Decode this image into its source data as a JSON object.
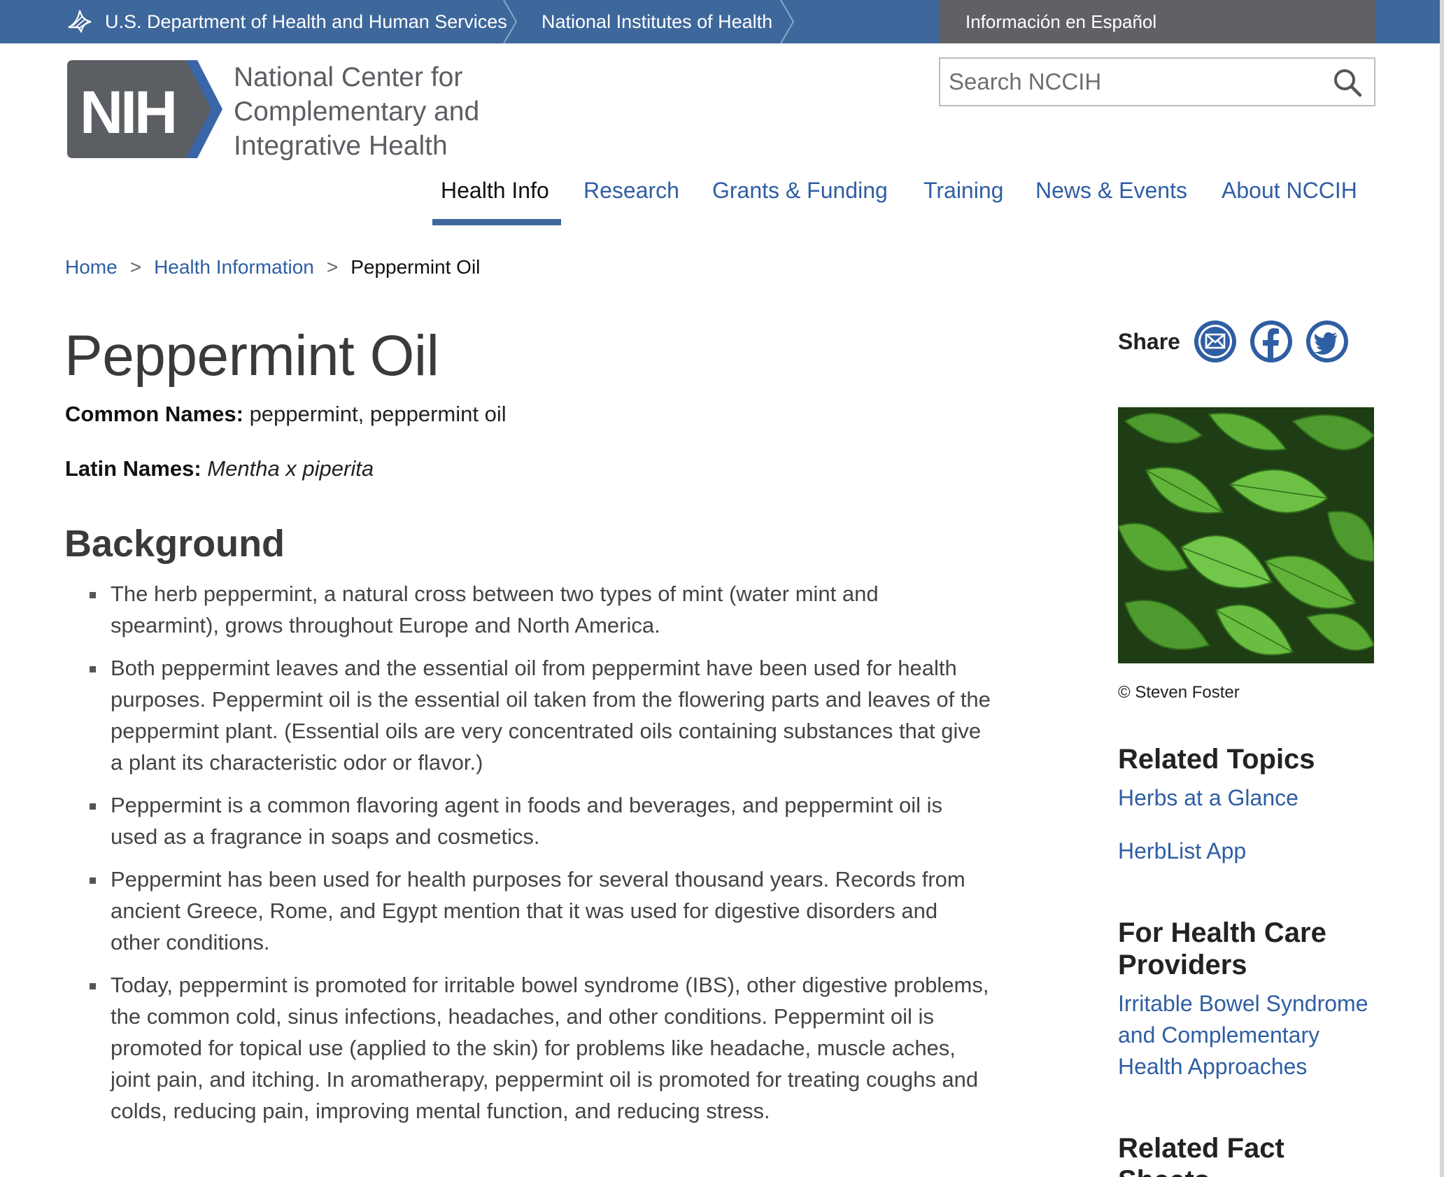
{
  "gov_bar": {
    "hhs_label": "U.S. Department of Health and Human Services",
    "nih_label": "National Institutes of Health",
    "espanol_label": "Información en Español"
  },
  "header": {
    "logo_text": "NIH",
    "org_line1": "National Center for",
    "org_line2": "Complementary and",
    "org_line3": "Integrative Health"
  },
  "search": {
    "placeholder": "Search NCCIH",
    "icon": "search-icon"
  },
  "nav": {
    "items": [
      {
        "label": "Health Info",
        "active": true
      },
      {
        "label": "Research"
      },
      {
        "label": "Grants & Funding"
      },
      {
        "label": "Training"
      },
      {
        "label": "News & Events"
      },
      {
        "label": "About NCCIH"
      }
    ]
  },
  "breadcrumb": {
    "home": "Home",
    "health_info": "Health Information",
    "current": "Peppermint Oil",
    "separator": ">"
  },
  "page": {
    "title": "Peppermint Oil",
    "common_label": "Common Names:",
    "common_value": "peppermint, peppermint oil",
    "latin_label": "Latin Names:",
    "latin_value": "Mentha x piperita",
    "section_heading": "Background",
    "bullets": [
      "The herb peppermint, a natural cross between two types of mint (water mint and spearmint), grows throughout Europe and North America.",
      "Both peppermint leaves and the essential oil from peppermint have been used for health purposes. Peppermint oil is the essential oil taken from the flowering parts and leaves of the peppermint plant. (Essential oils are very concentrated oils containing substances that give a plant its characteristic odor or flavor.)",
      "Peppermint is a common flavoring agent in foods and beverages, and peppermint oil is used as a fragrance in soaps and cosmetics.",
      "Peppermint has been used for health purposes for several thousand years. Records from ancient Greece, Rome, and Egypt mention that it was used for digestive disorders and other conditions.",
      "Today, peppermint is promoted for irritable bowel syndrome (IBS), other digestive problems, the common cold, sinus infections, headaches, and other conditions. Peppermint oil is promoted for topical use (applied to the skin) for problems like headache, muscle aches, joint pain, and itching. In aromatherapy, peppermint oil is promoted for treating coughs and colds, reducing pain, improving mental function, and reducing stress."
    ]
  },
  "sidebar": {
    "share_label": "Share",
    "share_icons": [
      "email-icon",
      "facebook-icon",
      "twitter-icon"
    ],
    "image_credit": "© Steven Foster",
    "related_topics_heading": "Related Topics",
    "related_topics": [
      "Herbs at a Glance",
      "HerbList App"
    ],
    "hcp_heading": "For Health Care Providers",
    "hcp_links": [
      "Irritable Bowel Syndrome and Complementary Health Approaches"
    ],
    "related_fact_sheets_heading": "Related Fact Sheets"
  },
  "colors": {
    "gov_bar": "#3e679b",
    "espanol_bg": "#5f6164",
    "link": "#2f5ea3",
    "logo_grey": "#5b5e62",
    "logo_blue": "#3a66a8"
  }
}
